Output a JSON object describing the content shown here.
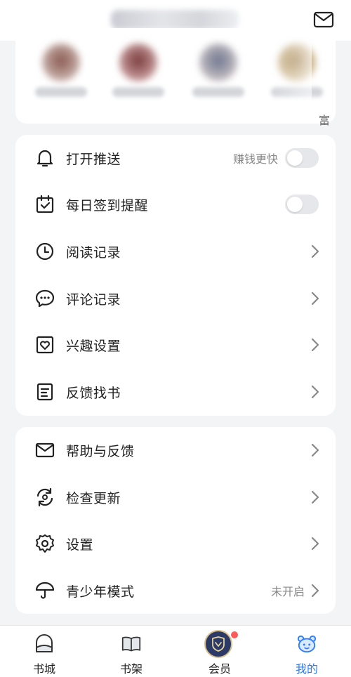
{
  "header": {
    "mail_icon": "mail-icon"
  },
  "avatars": {
    "edge_text": "富"
  },
  "list1": [
    {
      "icon": "bell-icon",
      "label": "打开推送",
      "hint": "赚钱更快",
      "control": "toggle",
      "on": false
    },
    {
      "icon": "calendar-check-icon",
      "label": "每日签到提醒",
      "control": "toggle",
      "on": false
    },
    {
      "icon": "clock-icon",
      "label": "阅读记录",
      "control": "chevron"
    },
    {
      "icon": "comment-icon",
      "label": "评论记录",
      "control": "chevron"
    },
    {
      "icon": "heart-frame-icon",
      "label": "兴趣设置",
      "control": "chevron"
    },
    {
      "icon": "document-icon",
      "label": "反馈找书",
      "control": "chevron"
    }
  ],
  "list2": [
    {
      "icon": "mail-icon",
      "label": "帮助与反馈",
      "control": "chevron"
    },
    {
      "icon": "refresh-icon",
      "label": "检查更新",
      "control": "chevron"
    },
    {
      "icon": "gear-icon",
      "label": "设置",
      "control": "chevron"
    },
    {
      "icon": "umbrella-icon",
      "label": "青少年模式",
      "hint": "未开启",
      "control": "chevron"
    }
  ],
  "bottom_nav": [
    {
      "icon": "home-icon",
      "label": "书城",
      "active": false
    },
    {
      "icon": "book-icon",
      "label": "书架",
      "active": false
    },
    {
      "icon": "vip-badge-icon",
      "label": "会员",
      "active": false,
      "badge_dot": true
    },
    {
      "icon": "bear-icon",
      "label": "我的",
      "active": true
    }
  ],
  "colors": {
    "accent": "#2b7cff",
    "background": "#f3f4f6",
    "card": "#ffffff",
    "badge_dot": "#ff5a5a",
    "vip": "#2c3a67"
  }
}
